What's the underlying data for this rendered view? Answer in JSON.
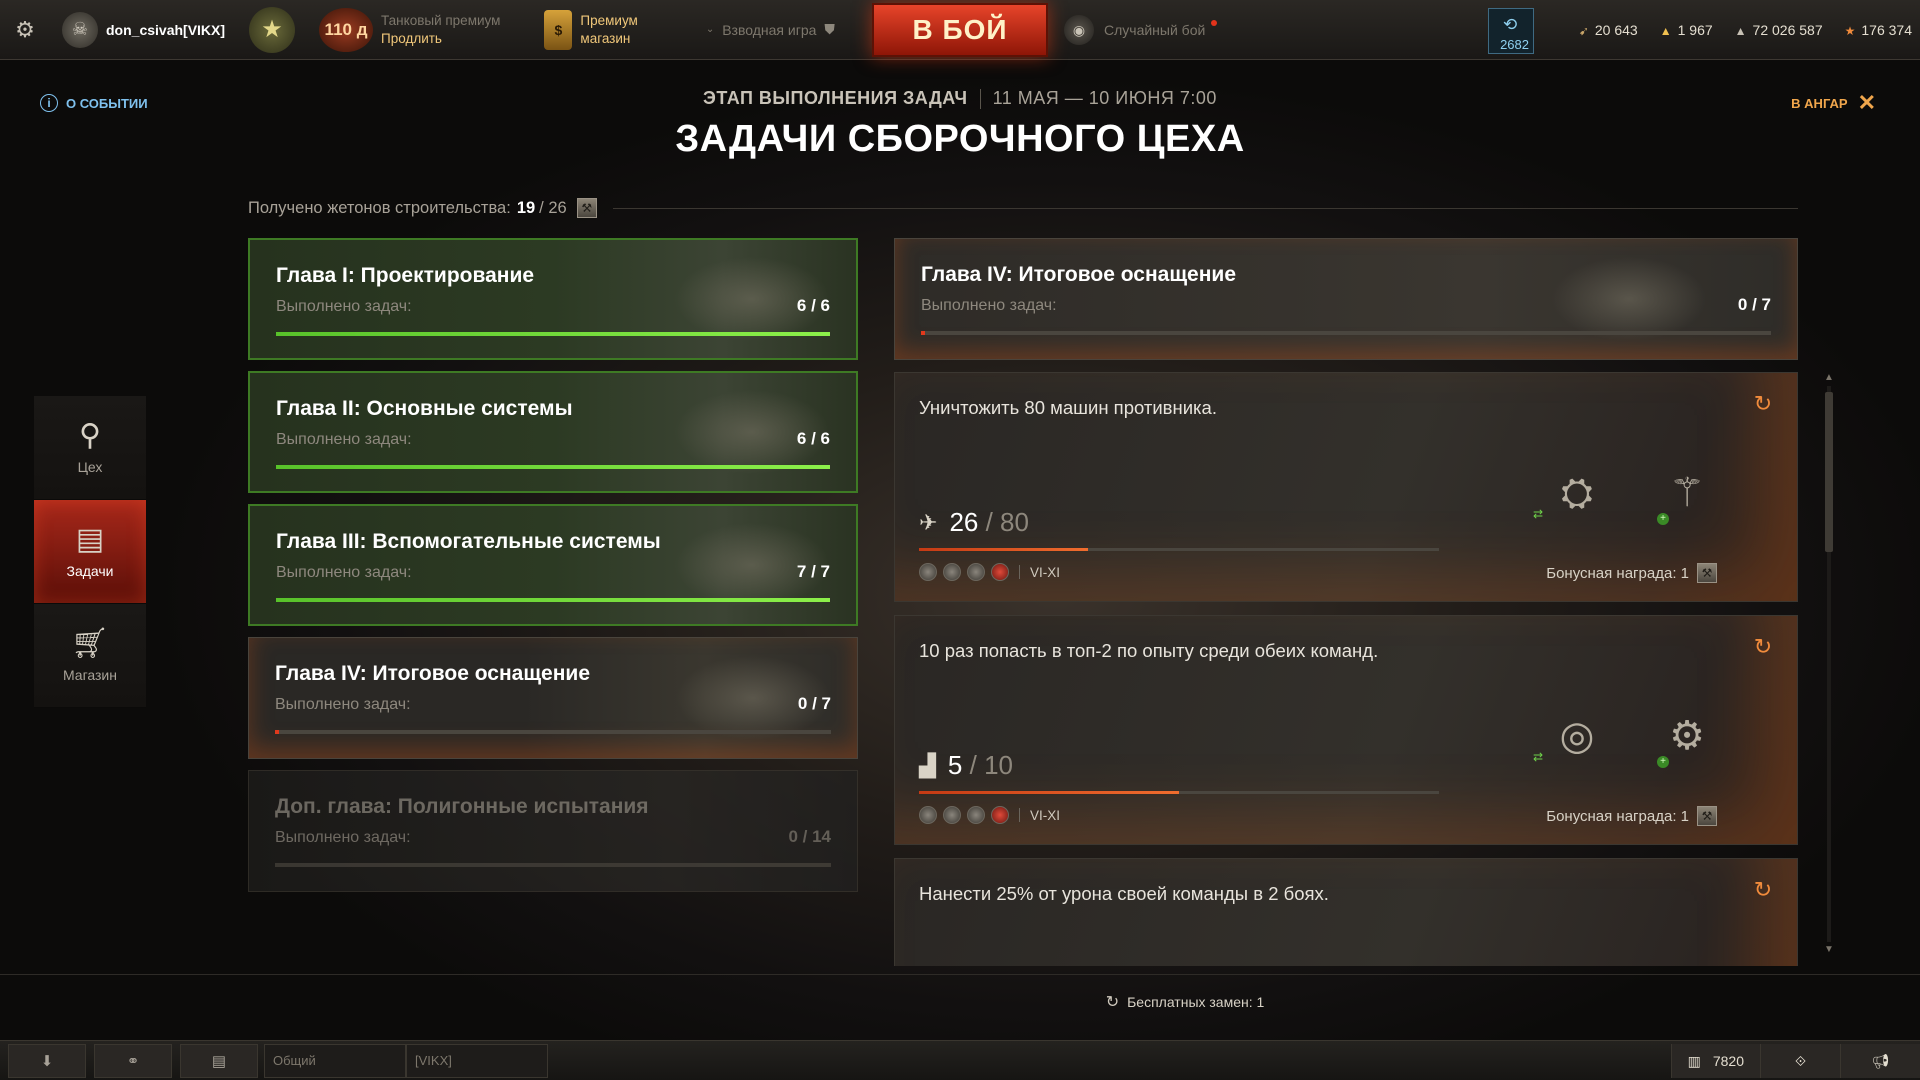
{
  "topbar": {
    "player_name": "don_csivah[VIKX]",
    "premium_days": "110 д",
    "premium_label": "Танковый премиум",
    "premium_action": "Продлить",
    "shop_line1": "Премиум",
    "shop_line2": "магазин",
    "platoon_label": "Взводная игра",
    "battle_button": "В БОЙ",
    "battle_mode": "Случайный бой",
    "free_xp_value": "2682",
    "currencies": [
      "20 643",
      "1 967",
      "72 026 587",
      "176 374"
    ]
  },
  "header": {
    "about_event": "О СОБЫТИИ",
    "to_hangar": "В АНГАР",
    "stage_label": "ЭТАП ВЫПОЛНЕНИЯ ЗАДАЧ",
    "stage_dates": "11 МАЯ — 10 ИЮНЯ 7:00",
    "title": "ЗАДАЧИ СБОРОЧНОГО ЦЕХА",
    "tokens_label": "Получено жетонов строительства:",
    "tokens_current": "19",
    "tokens_total": "/ 26"
  },
  "sidebar": [
    {
      "label": "Цех",
      "icon": "wrench-icon"
    },
    {
      "label": "Задачи",
      "icon": "tasks-list-icon",
      "active": true
    },
    {
      "label": "Магазин",
      "icon": "cart-icon"
    }
  ],
  "chapters": [
    {
      "name": "Глава I: Проектирование",
      "sub": "Выполнено задач:",
      "count": "6 / 6",
      "progress": 1.0,
      "state": "done"
    },
    {
      "name": "Глава II: Основные системы",
      "sub": "Выполнено задач:",
      "count": "6 / 6",
      "progress": 1.0,
      "state": "done"
    },
    {
      "name": "Глава III: Вспомогательные системы",
      "sub": "Выполнено задач:",
      "count": "7 / 7",
      "progress": 1.0,
      "state": "done"
    },
    {
      "name": "Глава IV: Итоговое оснащение",
      "sub": "Выполнено задач:",
      "count": "0 / 7",
      "progress": 0.0,
      "state": "current"
    },
    {
      "name": "Доп. глава: Полигонные испытания",
      "sub": "Выполнено задач:",
      "count": "0 / 14",
      "progress": 0.0,
      "state": "locked"
    }
  ],
  "selected_chapter": {
    "name": "Глава IV: Итоговое оснащение",
    "sub": "Выполнено задач:",
    "count": "0 / 7",
    "progress": 0.0
  },
  "tasks": [
    {
      "text": "Уничтожить 80 машин противника.",
      "current": "26",
      "total": "/ 80",
      "progress": 0.325,
      "tiers": "VI-XI",
      "bonus": "Бонусная награда: 1",
      "icon": "destroyed-tank-icon"
    },
    {
      "text": "10 раз попасть в топ-2 по опыту среди обеих команд.",
      "current": "5",
      "total": "/ 10",
      "progress": 0.5,
      "tiers": "VI-XI",
      "bonus": "Бонусная награда: 1",
      "icon": "podium-icon"
    },
    {
      "text": "Нанести 25% от урона своей команды в 2 боях."
    }
  ],
  "free_replacements": "Бесплатных замен: 1",
  "bottombar": {
    "chat_channel": "Общий",
    "chat_clan": "[VIKX]",
    "online_count": "7820"
  },
  "colors": {
    "accent_red": "#e3331b",
    "accent_orange": "#f0a64c",
    "progress_green": "#6ad43a",
    "info_blue": "#7fc1ee"
  }
}
